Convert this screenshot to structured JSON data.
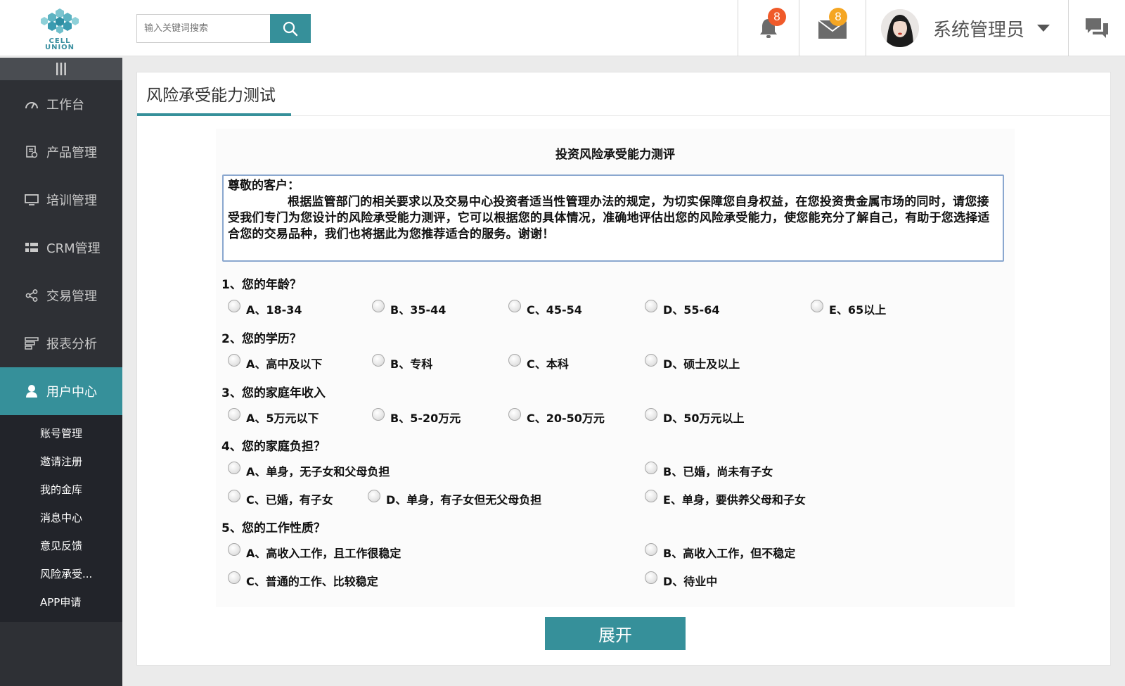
{
  "colors": {
    "accent": "#36909a",
    "sidebar": "#2e3035",
    "badge_bell": "#f05a2a",
    "badge_mail": "#f5a623"
  },
  "logo": {
    "line1": "CELL",
    "line2": "UNION"
  },
  "search": {
    "placeholder": "输入关键词搜索",
    "icon": "search-icon"
  },
  "header": {
    "notifications_count": "8",
    "messages_count": "8",
    "username": "系统管理员",
    "icons": [
      "bell-icon",
      "mail-icon",
      "caret-down-icon",
      "chat-icon"
    ]
  },
  "sidebar": {
    "items": [
      {
        "label": "工作台",
        "icon": "dashboard-icon"
      },
      {
        "label": "产品管理",
        "icon": "product-icon"
      },
      {
        "label": "培训管理",
        "icon": "monitor-icon"
      },
      {
        "label": "CRM管理",
        "icon": "grid-icon"
      },
      {
        "label": "交易管理",
        "icon": "share-icon"
      },
      {
        "label": "报表分析",
        "icon": "report-icon"
      },
      {
        "label": "用户中心",
        "icon": "user-icon"
      }
    ],
    "sub_items": [
      "账号管理",
      "邀请注册",
      "我的金库",
      "消息中心",
      "意见反馈",
      "风险承受...",
      "APP申请"
    ]
  },
  "page": {
    "tab_title": "风险承受能力测试",
    "expand_label": "展开"
  },
  "survey": {
    "title": "投资风险承受能力测评",
    "greeting": "尊敬的客户：",
    "intro": "根据监管部门的相关要求以及交易中心投资者适当性管理办法的规定，为切实保障您自身权益，在您投资贵金属市场的同时，请您接受我们专门为您设计的风险承受能力测评，它可以根据您的具体情况，准确地评估出您的风险承受能力，使您能充分了解自己，有助于您选择适合您的交易品种，我们也将据此为您推荐适合的服务。谢谢！",
    "questions": [
      {
        "text": "1、您的年龄？",
        "options": [
          "A、18-34",
          "B、35-44",
          "C、45-54",
          "D、55-64",
          "E、65以上"
        ]
      },
      {
        "text": "2、您的学历？",
        "options": [
          "A、高中及以下",
          "B、专科",
          "C、本科",
          "D、硕士及以上"
        ]
      },
      {
        "text": "3、您的家庭年收入",
        "options": [
          "A、5万元以下",
          "B、5-20万元",
          "C、20-50万元",
          "D、50万元以上"
        ]
      },
      {
        "text": "4、您的家庭负担？",
        "options": [
          "A、单身，无子女和父母负担",
          "B、已婚，尚未有子女",
          "C、已婚，有子女",
          "D、单身，有子女但无父母负担",
          "E、单身，要供养父母和子女"
        ]
      },
      {
        "text": "5、您的工作性质？",
        "options": [
          "A、高收入工作，且工作很稳定",
          "B、高收入工作，但不稳定",
          "C、普通的工作、比较稳定",
          "D、待业中"
        ]
      }
    ]
  }
}
